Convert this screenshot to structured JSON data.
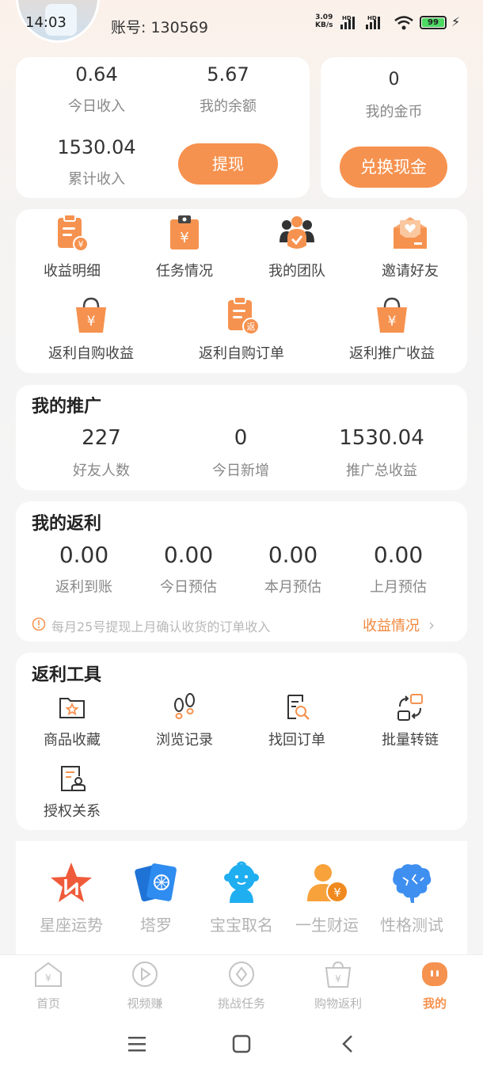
{
  "status_bar": {
    "time": "14:03",
    "net_speed_value": "3.09",
    "net_speed_unit": "KB/s",
    "battery": "99"
  },
  "header": {
    "account_label": "账号: 130569"
  },
  "earnings_card": {
    "today_income_value": "0.64",
    "today_income_label": "今日收入",
    "balance_value": "5.67",
    "balance_label": "我的余额",
    "total_income_value": "1530.04",
    "total_income_label": "累计收入",
    "withdraw_button": "提现"
  },
  "coins_card": {
    "coins_value": "0",
    "coins_label": "我的金币",
    "exchange_button": "兑换现金"
  },
  "quick_menu": {
    "items": [
      {
        "label": "收益明细",
        "icon": "income-detail-icon"
      },
      {
        "label": "任务情况",
        "icon": "task-status-icon"
      },
      {
        "label": "我的团队",
        "icon": "team-icon"
      },
      {
        "label": "邀请好友",
        "icon": "invite-friend-icon"
      },
      {
        "label": "返利自购收益",
        "icon": "rebate-self-income-icon"
      },
      {
        "label": "返利自购订单",
        "icon": "rebate-self-order-icon"
      },
      {
        "label": "返利推广收益",
        "icon": "rebate-promo-income-icon"
      }
    ]
  },
  "promotion": {
    "title": "我的推广",
    "stats": [
      {
        "value": "227",
        "label": "好友人数"
      },
      {
        "value": "0",
        "label": "今日新增"
      },
      {
        "value": "1530.04",
        "label": "推广总收益"
      }
    ]
  },
  "rebate": {
    "title": "我的返利",
    "stats": [
      {
        "value": "0.00",
        "label": "返利到账"
      },
      {
        "value": "0.00",
        "label": "今日预估"
      },
      {
        "value": "0.00",
        "label": "本月预估"
      },
      {
        "value": "0.00",
        "label": "上月预估"
      }
    ],
    "notice": "每月25号提现上月确认收货的订单收入",
    "link_label": "收益情况"
  },
  "tools": {
    "title": "返利工具",
    "items": [
      {
        "label": "商品收藏",
        "icon": "favorites-icon"
      },
      {
        "label": "浏览记录",
        "icon": "footprints-icon"
      },
      {
        "label": "找回订单",
        "icon": "find-order-icon"
      },
      {
        "label": "批量转链",
        "icon": "batch-convert-icon"
      },
      {
        "label": "授权关系",
        "icon": "authorization-icon"
      }
    ]
  },
  "fun": {
    "items": [
      {
        "label": "星座运势",
        "icon": "horoscope-star-icon"
      },
      {
        "label": "塔罗",
        "icon": "tarot-card-icon"
      },
      {
        "label": "宝宝取名",
        "icon": "baby-name-icon"
      },
      {
        "label": "一生财运",
        "icon": "fortune-icon"
      },
      {
        "label": "性格测试",
        "icon": "brain-icon"
      }
    ]
  },
  "tabbar": {
    "items": [
      {
        "label": "首页",
        "icon": "home-icon"
      },
      {
        "label": "视频赚",
        "icon": "video-icon"
      },
      {
        "label": "挑战任务",
        "icon": "challenge-icon"
      },
      {
        "label": "购物返利",
        "icon": "shopping-bag-icon"
      },
      {
        "label": "我的",
        "icon": "profile-icon"
      }
    ],
    "active_index": 4
  },
  "colors": {
    "accent": "#f6924f",
    "accent_link": "#f0883e",
    "muted_text": "#888888"
  }
}
